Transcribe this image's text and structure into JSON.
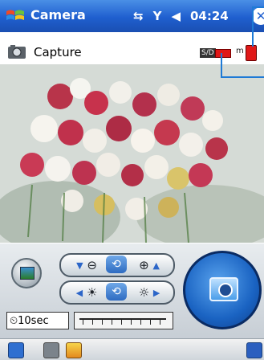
{
  "titlebar": {
    "title": "Camera",
    "time": "04:24",
    "icons": [
      "windows-start-icon",
      "connectivity-icon",
      "signal-icon",
      "volume-icon",
      "close-icon"
    ]
  },
  "subheader": {
    "label": "Capture",
    "storage_badge": "S/D",
    "memory_label": "m"
  },
  "controls": {
    "timer_label": "10sec",
    "zoom_control": {
      "left": "zoom-out",
      "right": "zoom-in"
    },
    "brightness_control": {
      "left": "brightness-down",
      "right": "brightness-up"
    }
  },
  "colors": {
    "titlebar_blue": "#1f5fcf",
    "indicator_red": "#e01818",
    "shutter_blue": "#1a63c2",
    "callout_blue": "#1e7ad6"
  }
}
